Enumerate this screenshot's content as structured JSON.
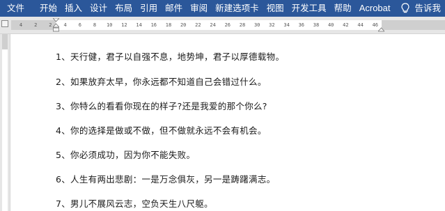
{
  "ribbon": {
    "tabs": [
      "文件",
      "开始",
      "插入",
      "设计",
      "布局",
      "引用",
      "邮件",
      "审阅",
      "新建选项卡",
      "视图",
      "开发工具",
      "帮助",
      "Acrobat"
    ],
    "tell_me": "告诉我",
    "share_partial": "♀",
    "colors": {
      "ribbon_bg": "#2b579a",
      "ribbon_text": "#ffffff"
    }
  },
  "ruler": {
    "numbers": [
      "4",
      "2",
      "2",
      "4",
      "6",
      "8",
      "10",
      "12",
      "14",
      "16",
      "18",
      "20",
      "22",
      "24",
      "26",
      "28",
      "30",
      "32",
      "34",
      "36",
      "38",
      "40",
      "42",
      "44",
      "46"
    ]
  },
  "document": {
    "paragraphs": [
      "1、天行健，君子以自强不息，地势坤，君子以厚德载物。",
      "2、如果放弃太早，你永远都不知道自己会错过什么。",
      "3、你特么的看看你现在的样子?还是我爱的那个你么?",
      "4、你的选择是做或不做，但不做就永远不会有机会。",
      "5、你必须成功，因为你不能失败。",
      "6、人生有两出悲剧：一是万念俱灰，另一是踌躇满志。",
      "7、男儿不展风云志，空负天生八尺躯。"
    ]
  }
}
